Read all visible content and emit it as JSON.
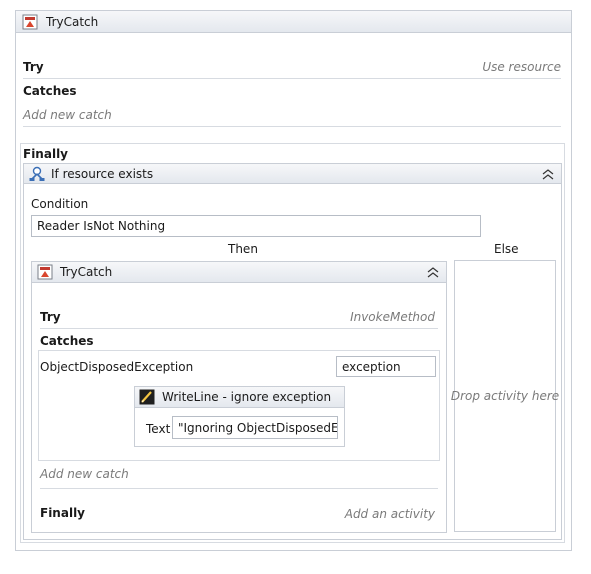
{
  "outer": {
    "title": "TryCatch",
    "try_label": "Try",
    "try_hint": "Use resource",
    "catches_label": "Catches",
    "add_catch": "Add new catch",
    "finally_label": "Finally"
  },
  "if_activity": {
    "title": "If resource exists",
    "condition_label": "Condition",
    "condition_value": "Reader IsNot Nothing",
    "then_label": "Then",
    "else_label": "Else",
    "else_drop": "Drop activity here"
  },
  "inner": {
    "title": "TryCatch",
    "try_label": "Try",
    "try_hint": "InvokeMethod",
    "catches_label": "Catches",
    "exception_type": "ObjectDisposedException",
    "exception_var": "exception",
    "add_catch": "Add new catch",
    "finally_label": "Finally",
    "finally_hint": "Add an activity"
  },
  "writeline": {
    "title": "WriteLine - ignore exception",
    "text_label": "Text",
    "text_value": "\"Ignoring ObjectDisposedException\""
  },
  "icons": {
    "trycatch": "trycatch-icon",
    "if": "if-activity-icon",
    "writeline": "writeline-icon",
    "collapse": "collapse-chevron-icon"
  },
  "colors": {
    "header_top": "#f6f7f9",
    "header_bottom": "#e4e8ee",
    "border": "#c9ced6",
    "hint": "#7a7a7a"
  }
}
